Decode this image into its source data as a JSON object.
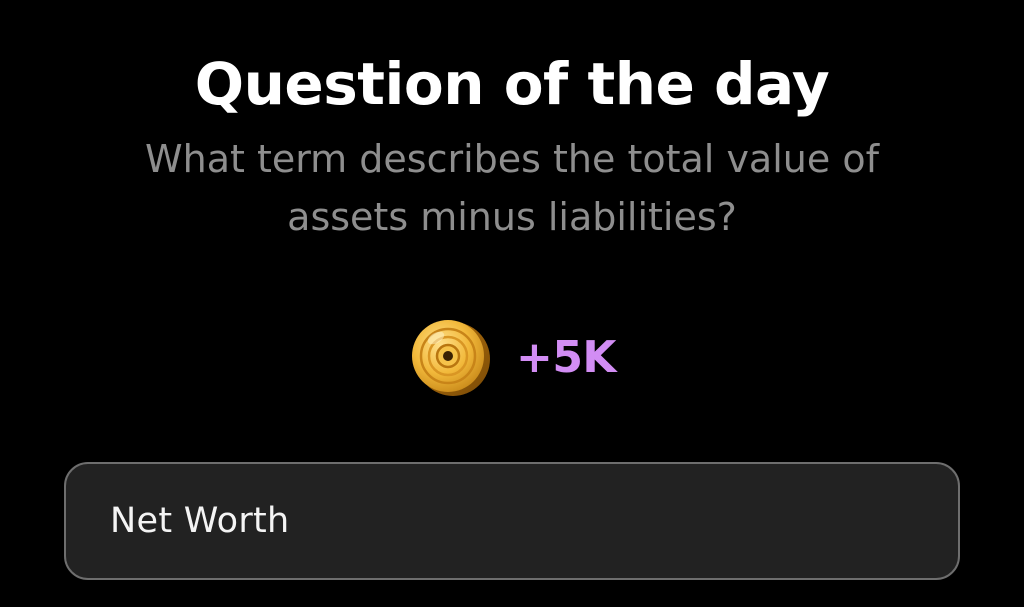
{
  "header": {
    "title": "Question of the day",
    "question": "What term describes the total value of assets minus liabilities?"
  },
  "reward": {
    "icon": "coin-icon",
    "amount": "+5K",
    "accent_color": "#d28df4"
  },
  "answer": {
    "value": "Net Worth"
  },
  "colors": {
    "background": "#000000",
    "title": "#ffffff",
    "question": "#8e8e8e",
    "field_background": "#222222",
    "field_border": "#6e6e6e"
  }
}
